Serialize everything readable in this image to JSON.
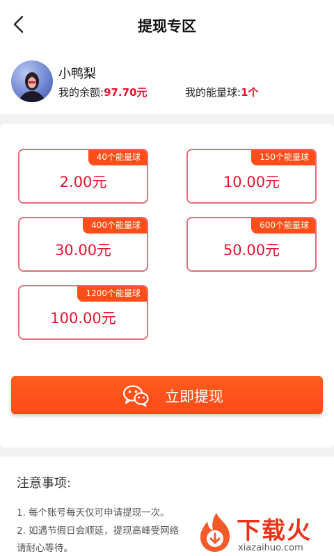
{
  "header": {
    "title": "提现专区",
    "back_icon": "chevron-left-icon"
  },
  "user": {
    "name": "小鸭梨",
    "balance_label": "我的余额:",
    "balance_value": "97.70元",
    "energy_label": "我的能量球:",
    "energy_value": "1个"
  },
  "options": [
    {
      "badge": "40个能量球",
      "amount": "2.00元"
    },
    {
      "badge": "150个能量球",
      "amount": "10.00元"
    },
    {
      "badge": "400个能量球",
      "amount": "30.00元"
    },
    {
      "badge": "600个能量球",
      "amount": "50.00元"
    },
    {
      "badge": "1200个能量球",
      "amount": "100.00元"
    }
  ],
  "withdraw_button": {
    "label": "立即提现",
    "icon": "wechat-icon"
  },
  "notes": {
    "title": "注意事项:",
    "items": [
      "1. 每个账号每天仅可申请提现一次。",
      "2. 如遇节假日会顺延，提现高峰受网络",
      "请耐心等待。"
    ]
  },
  "watermark": {
    "text": "下载火",
    "url": "xiazaihuo.com"
  },
  "colors": {
    "accent": "#ff4e1a",
    "price": "#e8122d",
    "border": "#e46b7a"
  }
}
